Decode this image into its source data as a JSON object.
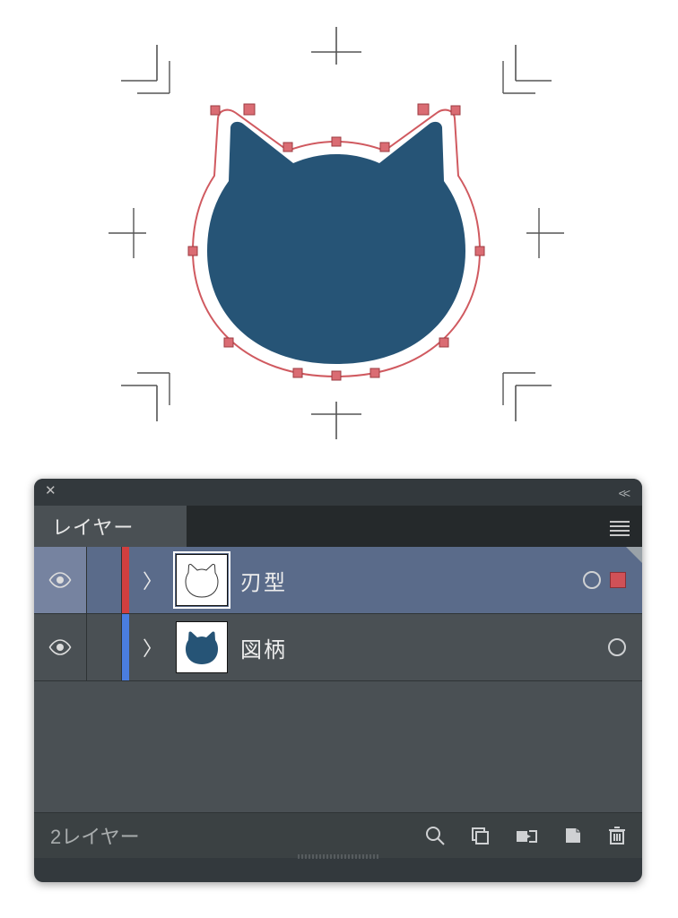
{
  "colors": {
    "cat_fill": "#265476",
    "die_line": "#d05a60",
    "anchor": "#da6c73",
    "panel_bg": "#33393d",
    "row_selected": "#5a6b8a"
  },
  "canvas": {
    "selected_shape": "cat-die-cut-path"
  },
  "panel": {
    "tab_label": "レイヤー",
    "layers": [
      {
        "name": "刃型",
        "color": "red",
        "visible": true,
        "selected": true,
        "has_selection_indicator": true
      },
      {
        "name": "図柄",
        "color": "blue",
        "visible": true,
        "selected": false,
        "has_selection_indicator": false
      }
    ],
    "footer": {
      "count_label": "2レイヤー"
    }
  }
}
